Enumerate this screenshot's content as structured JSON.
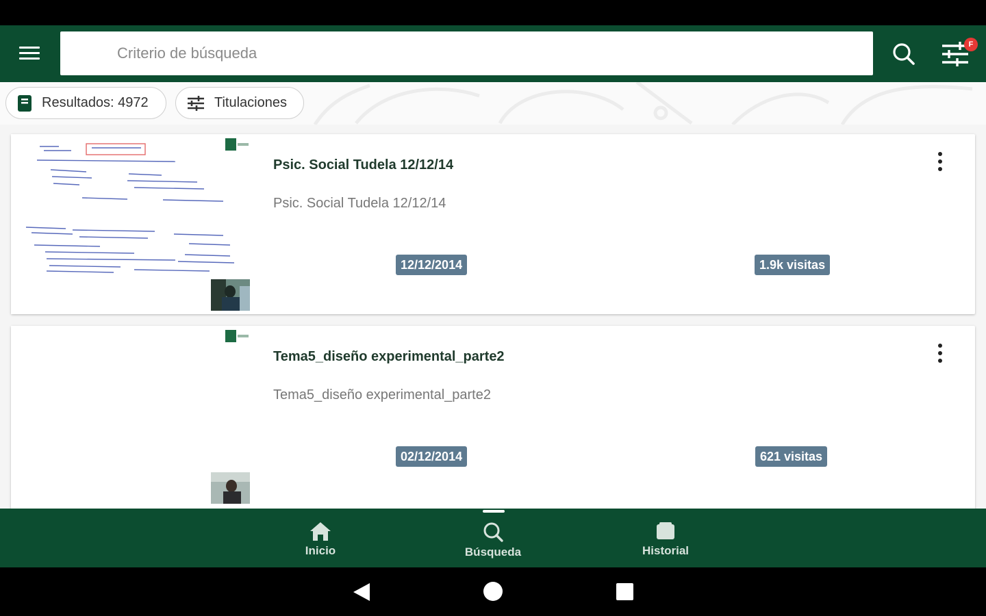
{
  "search": {
    "placeholder": "Criterio de búsqueda",
    "value": ""
  },
  "filters": {
    "badge": "F"
  },
  "chips": {
    "results": "Resultados: 4972",
    "degrees": "Titulaciones"
  },
  "results": [
    {
      "title": "Psic. Social Tudela 12/12/14",
      "subtitle": "Psic. Social Tudela 12/12/14",
      "date": "12/12/2014",
      "views": "1.9k visitas"
    },
    {
      "title": "Tema5_diseño experimental_parte2",
      "subtitle": "Tema5_diseño experimental_parte2",
      "date": "02/12/2014",
      "views": "621 visitas"
    }
  ],
  "nav": {
    "home": "Inicio",
    "search": "Búsqueda",
    "history": "Historial"
  },
  "colors": {
    "primary": "#0c4d30",
    "tag": "#5d7a90",
    "badge": "#e53935"
  }
}
